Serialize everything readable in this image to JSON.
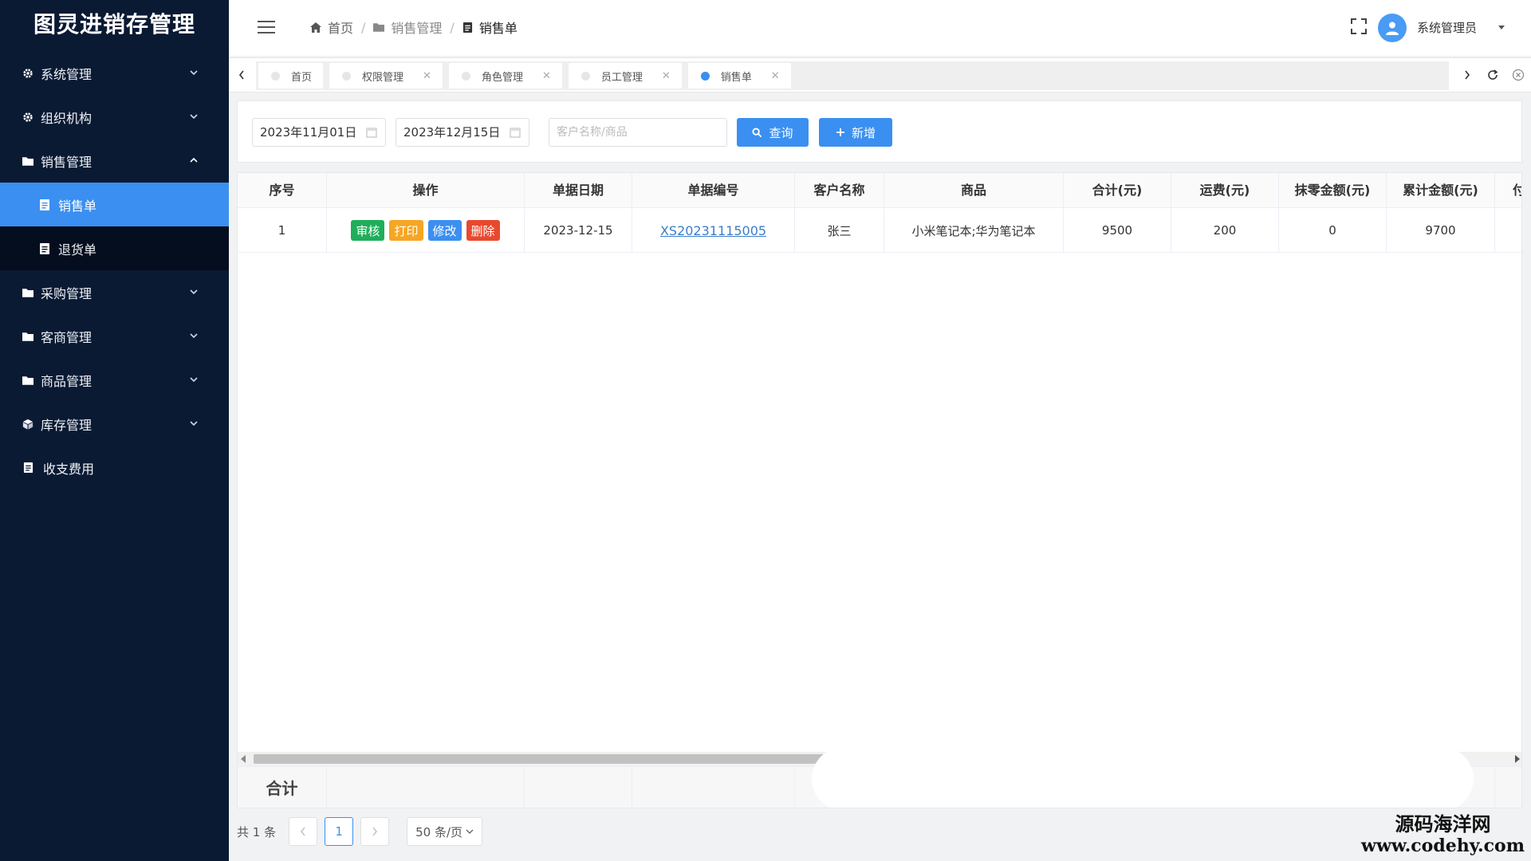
{
  "app": {
    "title": "图灵进销存管理"
  },
  "sidebar": {
    "items": [
      {
        "label": "系统管理",
        "icon": "gear-icon"
      },
      {
        "label": "组织机构",
        "icon": "gear-icon"
      },
      {
        "label": "销售管理",
        "icon": "folder-icon",
        "expanded": true,
        "children": [
          {
            "label": "销售单",
            "icon": "document-icon",
            "active": true
          },
          {
            "label": "退货单",
            "icon": "document-icon"
          }
        ]
      },
      {
        "label": "采购管理",
        "icon": "folder-icon"
      },
      {
        "label": "客商管理",
        "icon": "folder-icon"
      },
      {
        "label": "商品管理",
        "icon": "folder-icon"
      },
      {
        "label": "库存管理",
        "icon": "cube-icon"
      },
      {
        "label": "收支费用",
        "icon": "document-icon"
      }
    ],
    "colors": {
      "background": "#0b1a33",
      "active": "#3b8ff0"
    }
  },
  "header": {
    "breadcrumb": [
      "首页",
      "销售管理",
      "销售单"
    ],
    "user": "系统管理员"
  },
  "tabs": [
    {
      "label": "首页",
      "closable": false
    },
    {
      "label": "权限管理",
      "closable": true
    },
    {
      "label": "角色管理",
      "closable": true
    },
    {
      "label": "员工管理",
      "closable": true
    },
    {
      "label": "销售单",
      "closable": true,
      "active": true
    }
  ],
  "filter": {
    "start_date": "2023年11月01日",
    "end_date": "2023年12月15日",
    "search_placeholder": "客户名称/商品",
    "query_label": "查询",
    "add_label": "新增"
  },
  "table": {
    "columns": [
      "序号",
      "操作",
      "单据日期",
      "单据编号",
      "客户名称",
      "商品",
      "合计(元)",
      "运费(元)",
      "抹零金额(元)",
      "累计金额(元)",
      "付"
    ],
    "actions": [
      {
        "label": "审核",
        "color": "#1fae5b"
      },
      {
        "label": "打印",
        "color": "#f5a623"
      },
      {
        "label": "修改",
        "color": "#3b8ff0"
      },
      {
        "label": "删除",
        "color": "#e8492e"
      }
    ],
    "rows": [
      {
        "index": "1",
        "date": "2023-12-15",
        "code": "XS20231115005",
        "customer": "张三",
        "goods": "小米笔记本;华为笔记本",
        "total": "9500",
        "freight": "200",
        "discount": "0",
        "cumulative": "9700"
      }
    ],
    "summary_label": "合计"
  },
  "pagination": {
    "total_text": "共 1 条",
    "current_page": "1",
    "page_size": "50 条/页"
  },
  "watermark": {
    "line1": "源码海洋网",
    "line2": "www.codehy.com"
  }
}
